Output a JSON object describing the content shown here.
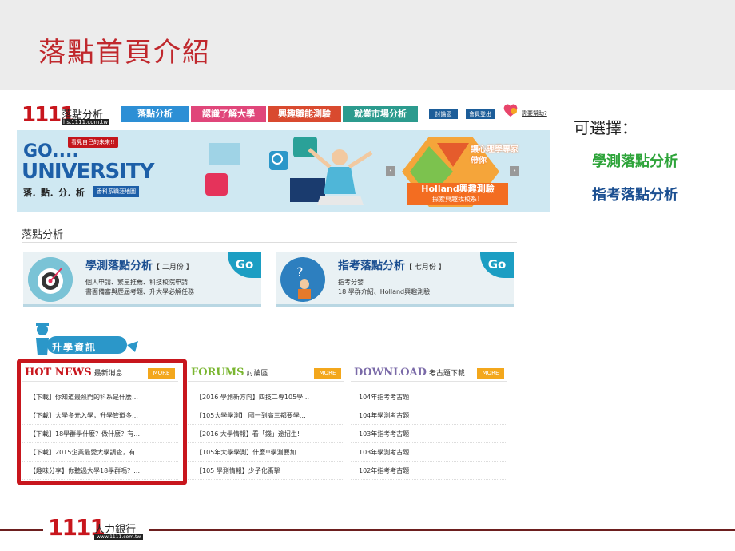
{
  "slide": {
    "title": "落點首頁介紹"
  },
  "site": {
    "logo_text": "1111",
    "logo_sub": "落點分析",
    "logo_url": "hs.1111.com.tw",
    "nav": [
      "落點分析",
      "認識了解大學",
      "興趣職能測驗",
      "就業市場分析"
    ],
    "member_btn": "討論區",
    "logout_btn": "會員登出",
    "help": "需要幫助?"
  },
  "banner": {
    "go": "GO....",
    "university": "UNIVERSITY",
    "tagline": "看見自己的未來!!",
    "subtitle": "落．點．分．析",
    "map_tag": "香科系職涯地圖",
    "holland_cta": "讓心理學專家帶你",
    "holland_title": "Holland興趣測驗",
    "holland_sub": "探索興趣找校系！"
  },
  "section": {
    "title": "落點分析"
  },
  "cards": [
    {
      "title": "學測落點分析",
      "month": "【 二月份 】",
      "line1": "個人申請、繁星推薦、科技校院申請",
      "line2": "書面備審與歷屆考題、升大學必解任務",
      "go": "Go"
    },
    {
      "title": "指考落點分析",
      "month": "【 七月份 】",
      "line1": "指考分發",
      "line2": "18 學群介紹、Holland興趣測驗",
      "go": "Go"
    }
  ],
  "info_logo": "升學資訊",
  "columns": [
    {
      "name": "HOT NEWS",
      "cn": "最新消息",
      "more": "MORE",
      "items": [
        "【下載】你知道最熱門的科系是什麼…",
        "【下載】大學多元入學，升學管道多…",
        "【下載】18學群學什麼？做什麼？有…",
        "【下載】2015企業最愛大學調查，有…",
        "【趣味分享】你聽過大學18學群嗎？…"
      ]
    },
    {
      "name": "FORUMS",
      "cn": "討論區",
      "more": "MORE",
      "items": [
        "【2016 學測新方向】四技二專105學…",
        "【105大學學測】 國一到高三都要學…",
        "【2016 大學情報】看「錢」途招生!",
        "【105年大學學測】什麼!!學測要加…",
        "【105 學測情報】少子化衝擊"
      ]
    },
    {
      "name": "DOWNLOAD",
      "cn": "考古題下載",
      "more": "MORE",
      "items": [
        "104年指考考古題",
        "104年學測考古題",
        "103年指考考古題",
        "103年學測考古題",
        "102年指考考古題"
      ]
    }
  ],
  "side": {
    "question": "可選擇：",
    "option1": "學測落點分析",
    "option2": "指考落點分析"
  },
  "footer": {
    "logo": "1111",
    "name": "人力銀行",
    "url": "www.1111.com.tw"
  },
  "colors": {
    "title_red": "#c0282d",
    "option_green": "#2ea43a",
    "option_blue": "#1b4f91",
    "highlight_red": "#c8161d"
  }
}
